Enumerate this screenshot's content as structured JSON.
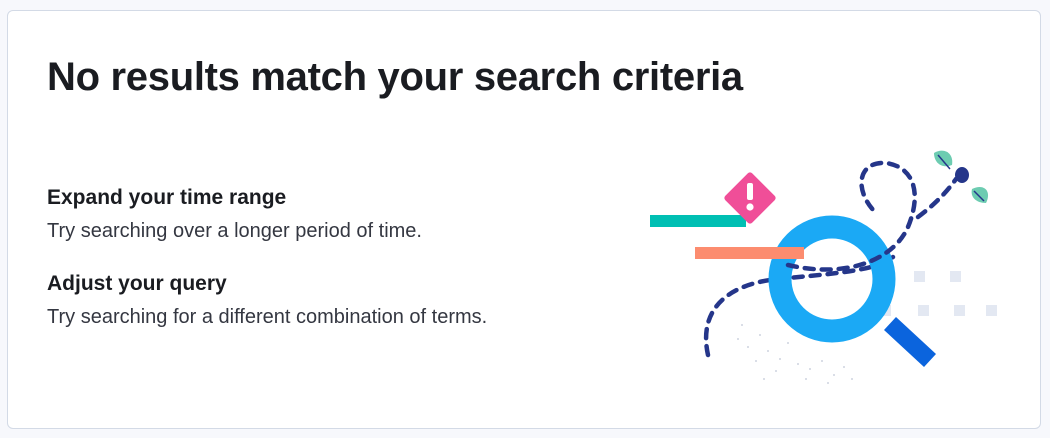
{
  "empty_state": {
    "title": "No results match your search criteria",
    "tips": [
      {
        "heading": "Expand your time range",
        "text": "Try searching over a longer period of time."
      },
      {
        "heading": "Adjust your query",
        "text": "Try searching for a different combination of terms."
      }
    ],
    "illustration": {
      "icon": "magnifying-glass-icon",
      "warning_icon": "warning-diamond-icon",
      "colors": {
        "lens": "#1ba9f5",
        "handle": "#0b64dd",
        "warning": "#f04e98",
        "teal_bar": "#00bfb3",
        "coral_bar": "#fc8c6f",
        "dashes": "#25368a",
        "squares": "#e3e8f2"
      }
    }
  }
}
